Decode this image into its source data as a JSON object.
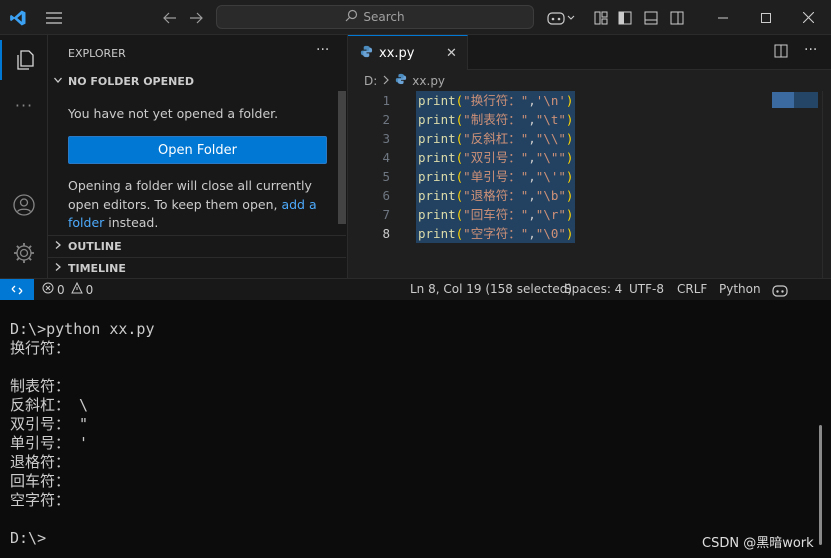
{
  "titlebar": {
    "search_label": "Search"
  },
  "sidebar": {
    "title": "EXPLORER",
    "more": "···",
    "no_folder_section": "NO FOLDER OPENED",
    "message1": "You have not yet opened a folder.",
    "open_folder_button": "Open Folder",
    "message2_before": "Opening a folder will close all currently open editors. To keep them open, ",
    "message2_link": "add a folder",
    "message2_after": " instead.",
    "outline_section": "OUTLINE",
    "timeline_section": "TIMELINE"
  },
  "editor": {
    "tab_label": "xx.py",
    "breadcrumb_root": "D:",
    "breadcrumb_file": "xx.py",
    "lines": [
      {
        "num": "1",
        "fn": "print",
        "arg1": "\"换行符：\"",
        "arg2": "'\\n'"
      },
      {
        "num": "2",
        "fn": "print",
        "arg1": "\"制表符：\"",
        "arg2": "\"\\t\""
      },
      {
        "num": "3",
        "fn": "print",
        "arg1": "\"反斜杠：\"",
        "arg2": "\"\\\\\""
      },
      {
        "num": "4",
        "fn": "print",
        "arg1": "\"双引号：\"",
        "arg2": "\"\\\"\""
      },
      {
        "num": "5",
        "fn": "print",
        "arg1": "\"单引号：\"",
        "arg2": "\"\\'\""
      },
      {
        "num": "6",
        "fn": "print",
        "arg1": "\"退格符：\"",
        "arg2": "\"\\b\""
      },
      {
        "num": "7",
        "fn": "print",
        "arg1": "\"回车符：\"",
        "arg2": "\"\\r\""
      },
      {
        "num": "8",
        "fn": "print",
        "arg1": "\"空字符：\"",
        "arg2": "\"\\0\""
      }
    ]
  },
  "statusbar": {
    "problems_errors": "0",
    "problems_warnings": "0",
    "cursor": "Ln 8, Col 19 (158 selected)",
    "indent": "Spaces: 4",
    "encoding": "UTF-8",
    "eol": "CRLF",
    "language": "Python"
  },
  "terminal": {
    "lines": [
      "D:\\>python xx.py",
      "换行符：",
      "",
      "制表符：",
      "反斜杠： \\",
      "双引号： \"",
      "单引号： '",
      "退格符：",
      "回车符：",
      "空字符：",
      "",
      "D:\\>"
    ],
    "watermark": "CSDN @黑暗work"
  }
}
